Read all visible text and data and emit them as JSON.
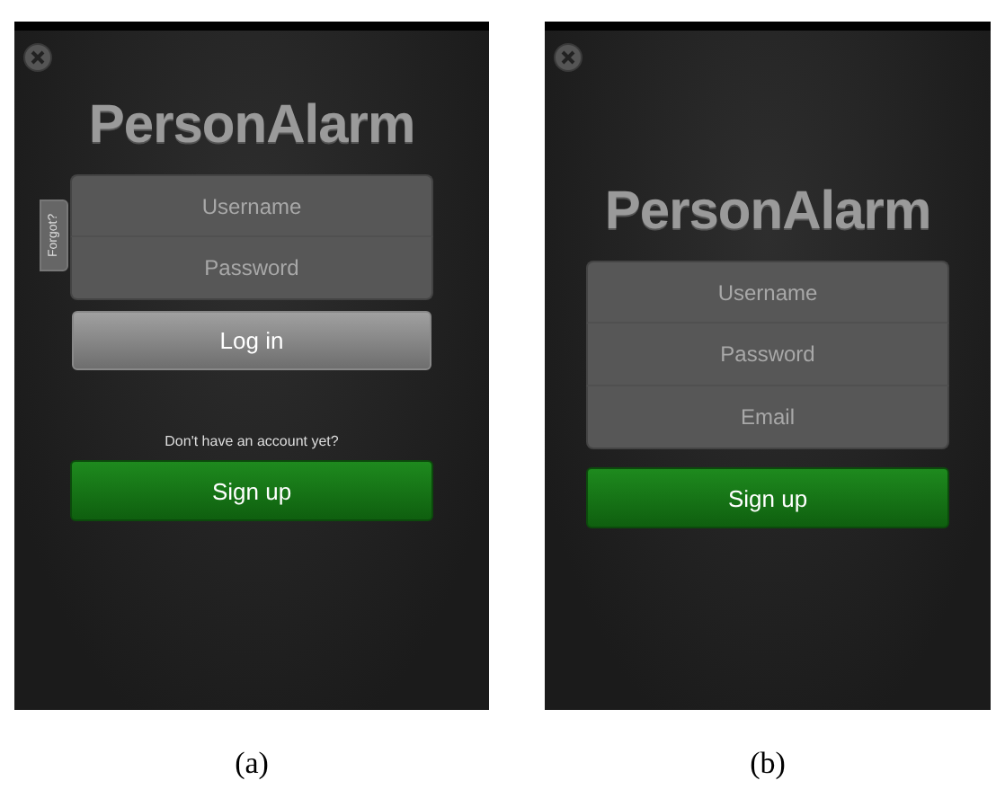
{
  "screens": [
    {
      "caption": "(a)",
      "title": "PersonAlarm",
      "fields": [
        {
          "placeholder": "Username"
        },
        {
          "placeholder": "Password"
        }
      ],
      "forgot_tab": "Forgot?",
      "login_button": "Log in",
      "prompt": "Don't have an account yet?",
      "signup_button": "Sign up"
    },
    {
      "caption": "(b)",
      "title": "PersonAlarm",
      "fields": [
        {
          "placeholder": "Username"
        },
        {
          "placeholder": "Password"
        },
        {
          "placeholder": "Email"
        }
      ],
      "signup_button": "Sign up"
    }
  ]
}
